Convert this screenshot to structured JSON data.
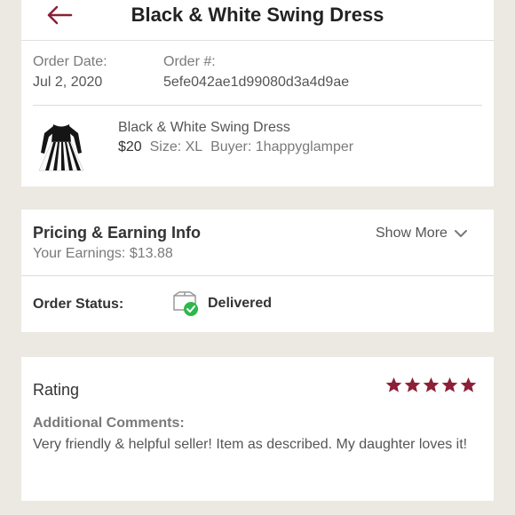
{
  "header": {
    "title": "Black & White Swing Dress"
  },
  "order": {
    "date_label": "Order Date:",
    "date_value": "Jul 2, 2020",
    "number_label": "Order #:",
    "number_value": "5efe042ae1d99080d3a4d9ae"
  },
  "item": {
    "title": "Black & White Swing Dress",
    "price": "$20",
    "size": "Size: XL",
    "buyer": "Buyer: 1happyglamper"
  },
  "pricing": {
    "title": "Pricing & Earning Info",
    "earnings": "Your Earnings: $13.88",
    "show_more": "Show More"
  },
  "status": {
    "label": "Order Status:",
    "value": "Delivered"
  },
  "rating": {
    "title": "Rating",
    "stars": 5,
    "comments_label": "Additional Comments:",
    "comments_text": "Very friendly & helpful seller! Item as described. My daughter loves it!"
  },
  "colors": {
    "accent": "#8b2036",
    "success": "#2eb84b",
    "background": "#ece9e3"
  }
}
